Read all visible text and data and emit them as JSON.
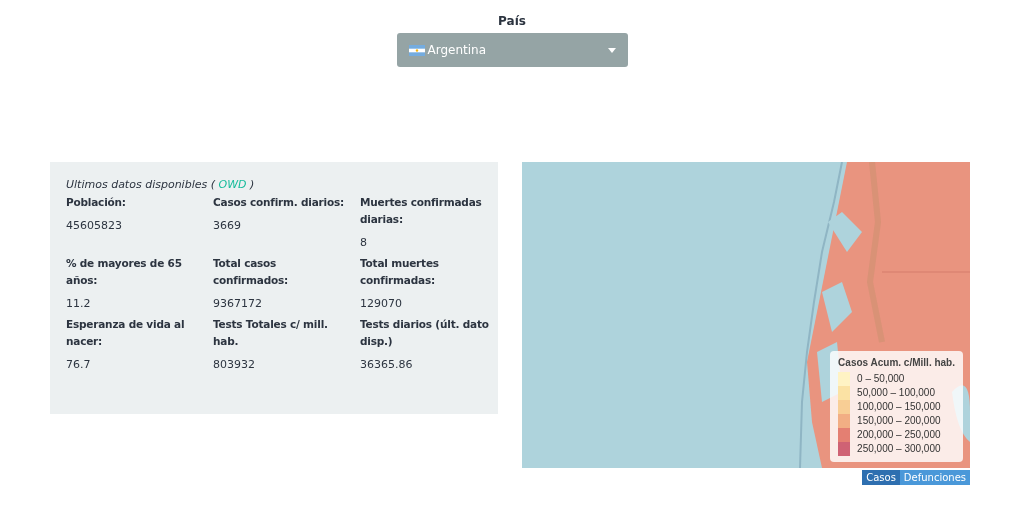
{
  "country_select": {
    "label": "País",
    "value": "Argentina"
  },
  "stats": {
    "heading": "Ultimos datos disponibles (",
    "source_link": "OWD",
    "heading_end": ")",
    "items": [
      {
        "label": "Población:",
        "value": "45605823"
      },
      {
        "label": "Casos confirm. diarios:",
        "value": "3669"
      },
      {
        "label": "Muertes confirmadas diarias:",
        "value": "8"
      },
      {
        "label": "% de mayores de 65 años:",
        "value": "11.2"
      },
      {
        "label": "Total casos confirmados:",
        "value": "9367172"
      },
      {
        "label": "Total muertes confirmadas:",
        "value": "129070"
      },
      {
        "label": "Esperanza de vida al nacer:",
        "value": "76.7"
      },
      {
        "label": "Tests Totales c/ mill. hab.",
        "value": "803932"
      },
      {
        "label": "Tests diarios (últ. dato disp.)",
        "value": "36365.86"
      }
    ]
  },
  "map": {
    "kind": "picture",
    "legend": {
      "title": "Casos Acum. c/Mill. hab.",
      "items": [
        {
          "label": "0 – 50,000",
          "color": "#fff3c4"
        },
        {
          "label": "50,000 – 100,000",
          "color": "#fbe2a4"
        },
        {
          "label": "100,000 – 150,000",
          "color": "#f8ce95"
        },
        {
          "label": "150,000 – 200,000",
          "color": "#f2ae84"
        },
        {
          "label": "200,000 – 250,000",
          "color": "#e47f72"
        },
        {
          "label": "250,000 – 300,000",
          "color": "#cf6274"
        }
      ]
    },
    "toggle": [
      {
        "label": "Casos",
        "selected": true
      },
      {
        "label": "Defunciones",
        "selected": false
      }
    ]
  }
}
